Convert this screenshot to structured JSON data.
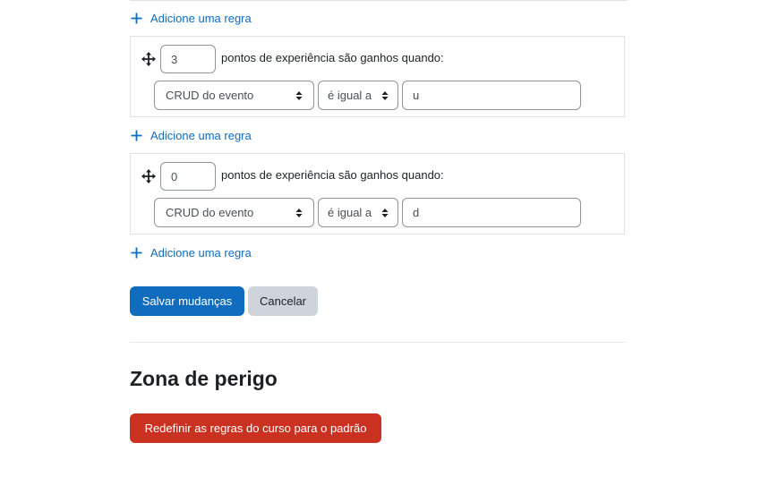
{
  "colors": {
    "link": "#0f6cbf",
    "primary": "#0f6cbf",
    "secondary": "#ced4da",
    "danger": "#ca3120",
    "border": "#dee2e6"
  },
  "add_rule_label": "Adicione uma regra",
  "rules": [
    {
      "points": "3",
      "points_label": "pontos de experiência são ganhos quando:",
      "field": "CRUD do evento",
      "operator": "é igual a",
      "value": "u"
    },
    {
      "points": "0",
      "points_label": "pontos de experiência são ganhos quando:",
      "field": "CRUD do evento",
      "operator": "é igual a",
      "value": "d"
    }
  ],
  "icons": {
    "move": "move-icon",
    "add": "plus-icon",
    "select_caret": "sort-caret-icon"
  },
  "actions": {
    "save_label": "Salvar mudanças",
    "cancel_label": "Cancelar"
  },
  "danger_zone": {
    "title": "Zona de perigo",
    "reset_label": "Redefinir as regras do curso para o padrão"
  }
}
